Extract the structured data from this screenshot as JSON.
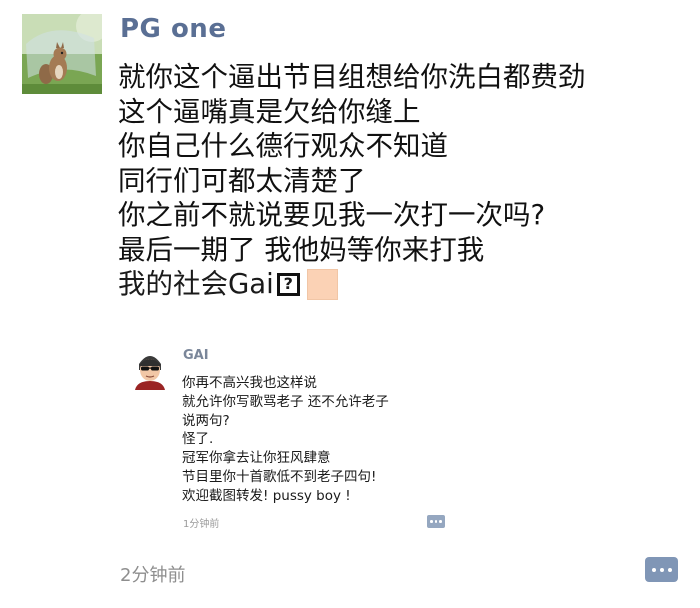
{
  "post": {
    "author": "PG one",
    "avatar_icon": "squirrel-avatar-icon",
    "lines": [
      "就你这个逼出节目组想给你洗白都费劲",
      "这个逼嘴真是欠给你缝上",
      "你自己什么德行观众不知道",
      "同行们可都太清楚了",
      "你之前不就说要见我一次打一次吗?",
      "最后一期了 我他妈等你来打我"
    ],
    "last_line": "我的社会Gai",
    "emoji_placeholder": "?",
    "emoji_skin_tone_color": "#fbd2b5",
    "timestamp": "2分钟前",
    "comment_icon": "comment-dots-icon"
  },
  "embedded": {
    "author": "GAI",
    "avatar_icon": "sunglasses-man-avatar-icon",
    "lines": [
      "你再不高兴我也这样说",
      "就允许你写歌骂老子 还不允许老子",
      "说两句?",
      "怪了.",
      "冠军你拿去让你狂风肆意",
      "节目里你十首歌低不到老子四句!",
      "欢迎截图转发! pussy boy !"
    ],
    "timestamp": "1分钟前",
    "comment_icon": "comment-dots-icon"
  },
  "colors": {
    "author_name": "#5a6f94",
    "embedded_name": "#7a8699",
    "timestamp": "#8e8e8e",
    "comment_button": "#8096b6",
    "background": "#ffffff"
  }
}
